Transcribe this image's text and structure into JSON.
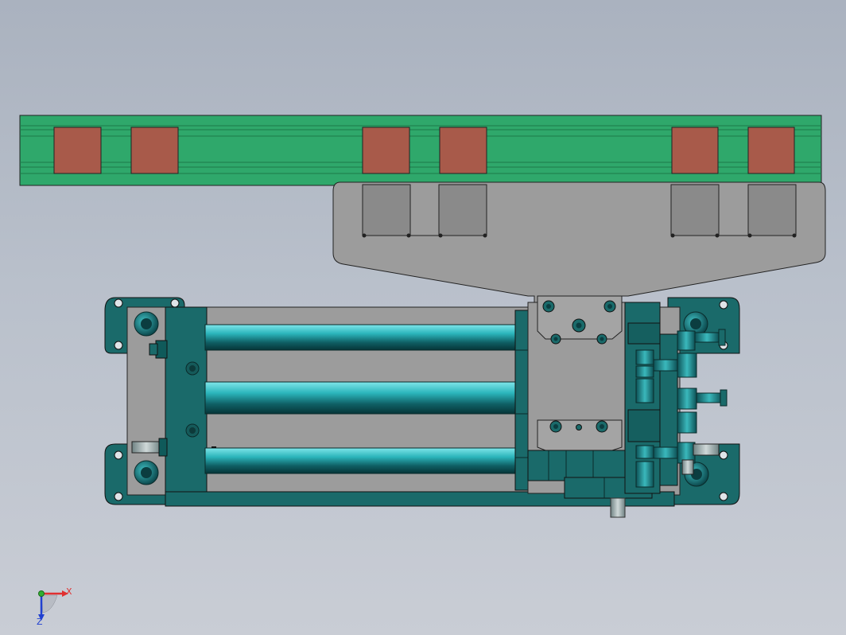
{
  "viewport": {
    "background_top": "#aab2bf",
    "background_bottom": "#c9cdd5"
  },
  "colors": {
    "rail_green": "#2fa86b",
    "rail_line": "#1e7a4a",
    "block_brown": "#a85a4a",
    "plate_gray": "#9c9c9c",
    "dark_teal": "#1a6a6a",
    "rod_cyan": "#29b3b8",
    "outline": "#222222"
  },
  "triad": {
    "x_label": "X",
    "z_label": "Z",
    "x_color": "#e03030",
    "y_color": "#30b030",
    "z_color": "#2040d0"
  }
}
